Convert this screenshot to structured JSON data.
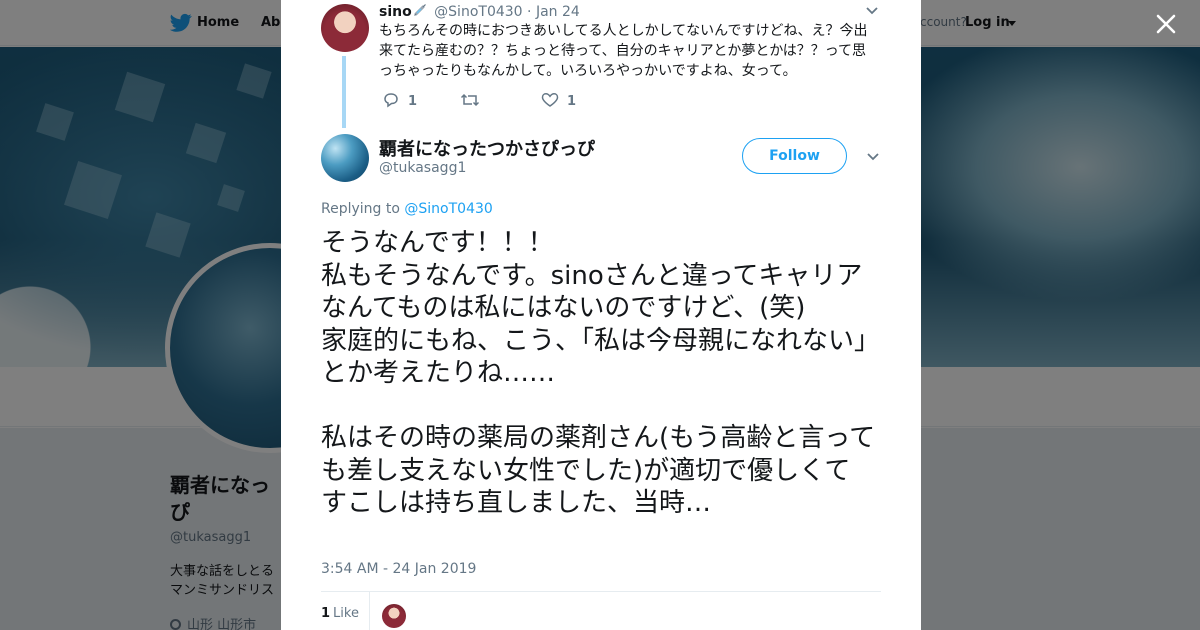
{
  "topbar": {
    "home_label": "Home",
    "about_label": "Abo",
    "account_prompt": "ccount?",
    "login_label": "Log in",
    "bird_icon": "twitter-bird-icon",
    "brand_color": "#1da1f2"
  },
  "profile_background": {
    "name": "覇者になっ\nぴ",
    "handle": "@tukasagg1",
    "bio": "大事な話をしとる\nマンミサンドリス",
    "location": "山形 山形市"
  },
  "close_icon": "close-icon",
  "parent_tweet": {
    "name": "sino",
    "emoji_icon": "syringe-icon",
    "handle": "@SinoT0430",
    "separator": "·",
    "date": "Jan 24",
    "text": "もちろんその時におつきあいしてる人としかしてないんですけどね、え？今出来てたら産むの？？ちょっと待って、自分のキャリアとか夢とかは？？って思っちゃったりもなんかして。いろいろやっかいですよね、女って。",
    "reply_count": "1",
    "retweet_count": "",
    "like_count": "1"
  },
  "main_tweet": {
    "name": "覇者になったつかさぴっぴ",
    "handle": "@tukasagg1",
    "follow_label": "Follow",
    "replying_prefix": "Replying to",
    "replying_handle": "@SinoT0430",
    "text": "そうなんです！！！\n私もそうなんです。sinoさんと違ってキャリアなんてものは私にはないのですけど、(笑)\n家庭的にもね、こう、「私は今母親になれない」とか考えたりね……\n\n私はその時の薬局の薬剤さん(もう高齢と言っても差し支えない女性でした)が適切で優しくて\nすこしは持ち直しました、当時…",
    "timestamp": "3:54 AM - 24 Jan 2019",
    "like_count": "1",
    "like_label": "Like"
  }
}
